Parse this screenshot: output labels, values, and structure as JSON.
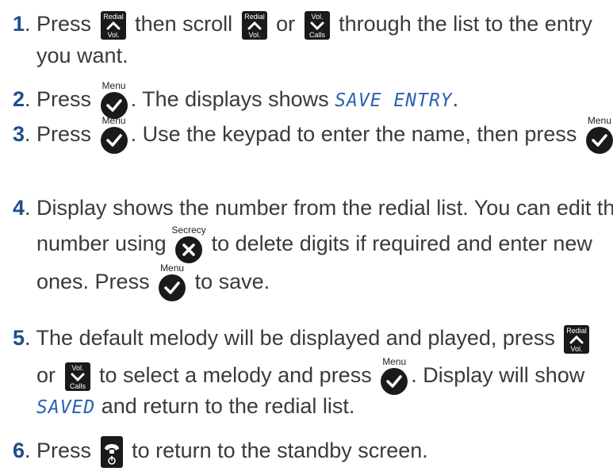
{
  "steps": [
    {
      "num": "1",
      "parts": {
        "a": ". Press ",
        "b": " then scroll ",
        "c": " or ",
        "d": " through the list to the entry",
        "e": "you want."
      }
    },
    {
      "num": "2",
      "parts": {
        "a": ". Press ",
        "b": ". The displays shows ",
        "lcd": "SAVE ENTRY",
        "c": "."
      }
    },
    {
      "num": "3",
      "parts": {
        "a": ". Press ",
        "b": ". Use the keypad to enter the name, then press ",
        "c": "."
      }
    },
    {
      "num": "4",
      "parts": {
        "a": ". Display shows the number from the redial list. You can edit the",
        "b": "number using ",
        "c": " to delete digits if required and enter new",
        "d": "ones. Press ",
        "e": " to save."
      }
    },
    {
      "num": "5",
      "parts": {
        "a": ". The default melody will be displayed and played, press ",
        "b": "or ",
        "c": " to select a melody and press ",
        "d": ". Display will show",
        "lcd": "SAVED",
        "e": " and return to the redial list."
      }
    },
    {
      "num": "6",
      "parts": {
        "a": ". Press ",
        "b": " to return to the standby screen."
      }
    }
  ],
  "keys": {
    "redial_top": "Redial",
    "redial_bottom": "Vol.",
    "vol_top": "Vol.",
    "vol_bottom": "Calls",
    "menu_label": "Menu",
    "secrecy_label": "Secrecy"
  },
  "colors": {
    "step_number": "#1f4e8c",
    "lcd_text": "#2a62b0",
    "key_fill": "#1a1a1a",
    "body_text": "#3a3a3a"
  }
}
